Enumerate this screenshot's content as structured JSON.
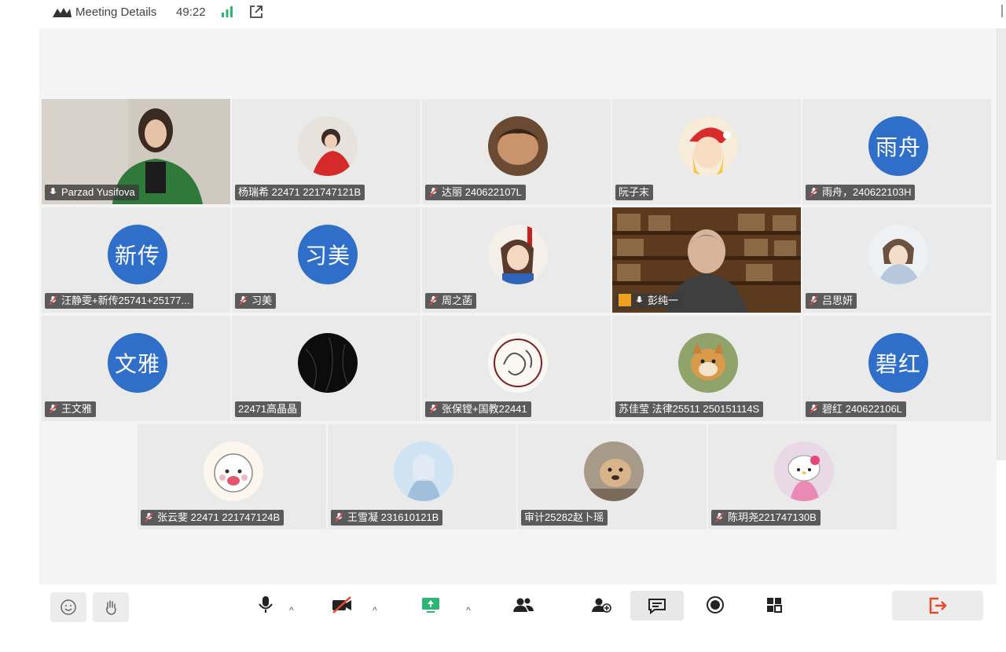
{
  "header": {
    "title": "Meeting Details",
    "timer": "49:22",
    "icons": [
      "meeting-logo-icon",
      "signal-icon",
      "popout-icon"
    ],
    "signal_color": "#2bb673"
  },
  "colors": {
    "active_speaker_border": "#35c06a",
    "avatar_bg": "#2f6fc9",
    "leave_icon": "#e8472b",
    "host_badge": "#f0a01b"
  },
  "participants": [
    {
      "name": "Parzad Yusifova",
      "type": "video",
      "active": true
    },
    {
      "name": "杨瑞希 22471 221747121B",
      "type": "photo",
      "muted": false
    },
    {
      "name": "达丽 240622107L",
      "type": "photo",
      "muted": true
    },
    {
      "name": "阮子末",
      "type": "photo",
      "muted": false
    },
    {
      "name": "雨舟，240622103H",
      "avatar_text": "雨舟",
      "type": "text",
      "muted": true
    },
    {
      "name": "汪静雯+新传25741+25177...",
      "avatar_text": "新传",
      "type": "text",
      "muted": true
    },
    {
      "name": "习美",
      "avatar_text": "习美",
      "type": "text",
      "muted": true
    },
    {
      "name": "周之菡",
      "type": "photo",
      "muted": true
    },
    {
      "name": "彭纯一",
      "type": "video",
      "host": true
    },
    {
      "name": "吕思妍",
      "type": "photo",
      "muted": true
    },
    {
      "name": "王文雅",
      "avatar_text": "文雅",
      "type": "text",
      "muted": true
    },
    {
      "name": "22471高晶晶",
      "type": "photo",
      "muted": false
    },
    {
      "name": "张保镗+国教22441",
      "type": "photo",
      "muted": true
    },
    {
      "name": "苏佳莹 法律25511 250151114S",
      "type": "photo",
      "muted": false
    },
    {
      "name": "碧红 240622106L",
      "avatar_text": "碧红",
      "type": "text",
      "muted": true
    },
    {
      "name": "张云斐 22471 221747124B",
      "type": "photo",
      "muted": true
    },
    {
      "name": "王雪凝 231610121B",
      "type": "photo",
      "muted": true
    },
    {
      "name": "审计25282赵卜瑶",
      "type": "photo",
      "muted": false
    },
    {
      "name": "陈玥尧221747130B",
      "type": "photo",
      "muted": true
    }
  ],
  "toolbar": {
    "left": [
      "emoji-icon",
      "raise-hand-icon"
    ],
    "center": [
      "microphone-icon",
      "camera-off-icon",
      "screen-share-icon",
      "participants-icon",
      "invite-icon",
      "chat-icon",
      "record-icon",
      "apps-icon"
    ],
    "right": [
      "leave-icon"
    ]
  }
}
